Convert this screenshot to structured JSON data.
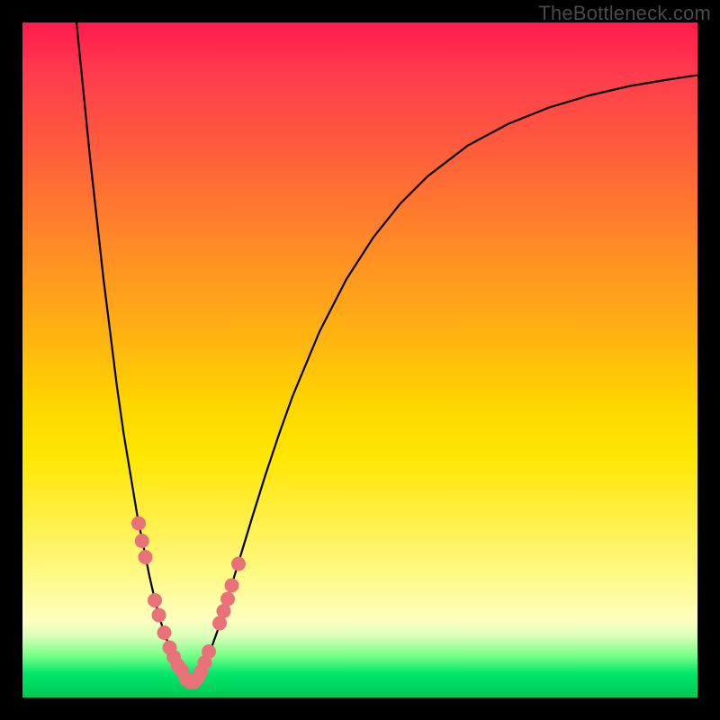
{
  "watermark": "TheBottleneck.com",
  "chart_data": {
    "type": "line",
    "title": "",
    "xlabel": "",
    "ylabel": "",
    "xlim": [
      0,
      100
    ],
    "ylim": [
      0,
      100
    ],
    "grid": false,
    "legend": false,
    "series": [
      {
        "name": "curve-left",
        "x": [
          8,
          9,
          10,
          11,
          12,
          13,
          14,
          15,
          16,
          17,
          18,
          18.8,
          19.6,
          20.4,
          21.2,
          22.0,
          22.8,
          23.6,
          24.4,
          25.2
        ],
        "y": [
          100,
          90,
          80,
          71,
          62,
          54,
          46,
          39,
          33,
          27,
          22,
          18,
          14.5,
          11.5,
          9,
          7,
          5.5,
          4,
          3,
          2.2
        ]
      },
      {
        "name": "curve-right",
        "x": [
          25.2,
          26,
          27,
          28,
          29,
          30,
          32,
          34,
          36,
          38,
          40,
          44,
          48,
          52,
          56,
          60,
          66,
          72,
          78,
          84,
          90,
          96,
          100
        ],
        "y": [
          2.2,
          3.2,
          5.0,
          7.4,
          10.2,
          13.4,
          20.0,
          26.6,
          33.0,
          39.0,
          44.6,
          54.2,
          62.0,
          68.2,
          73.2,
          77.2,
          81.8,
          85.0,
          87.4,
          89.2,
          90.6,
          91.6,
          92.2
        ]
      },
      {
        "name": "dots-left",
        "marker": "point",
        "x": [
          17.2,
          17.7,
          18.2,
          19.6,
          20.2,
          21.0,
          21.8,
          22.4,
          23.0,
          23.6
        ],
        "y": [
          25.8,
          23.2,
          20.8,
          14.4,
          12.2,
          9.6,
          7.4,
          6.0,
          4.8,
          4.0
        ]
      },
      {
        "name": "dots-right",
        "marker": "point",
        "x": [
          26.4,
          27.0,
          27.6,
          29.2,
          29.8,
          30.4,
          31.0,
          32.0
        ],
        "y": [
          3.8,
          5.2,
          6.8,
          11.0,
          12.8,
          14.6,
          16.6,
          19.8
        ]
      },
      {
        "name": "dots-bottom",
        "marker": "point",
        "x": [
          24.2,
          24.8,
          25.4,
          26.0
        ],
        "y": [
          2.8,
          2.3,
          2.3,
          3.0
        ]
      }
    ],
    "colors": {
      "curve": "#000000",
      "dots": "#e87278"
    }
  }
}
